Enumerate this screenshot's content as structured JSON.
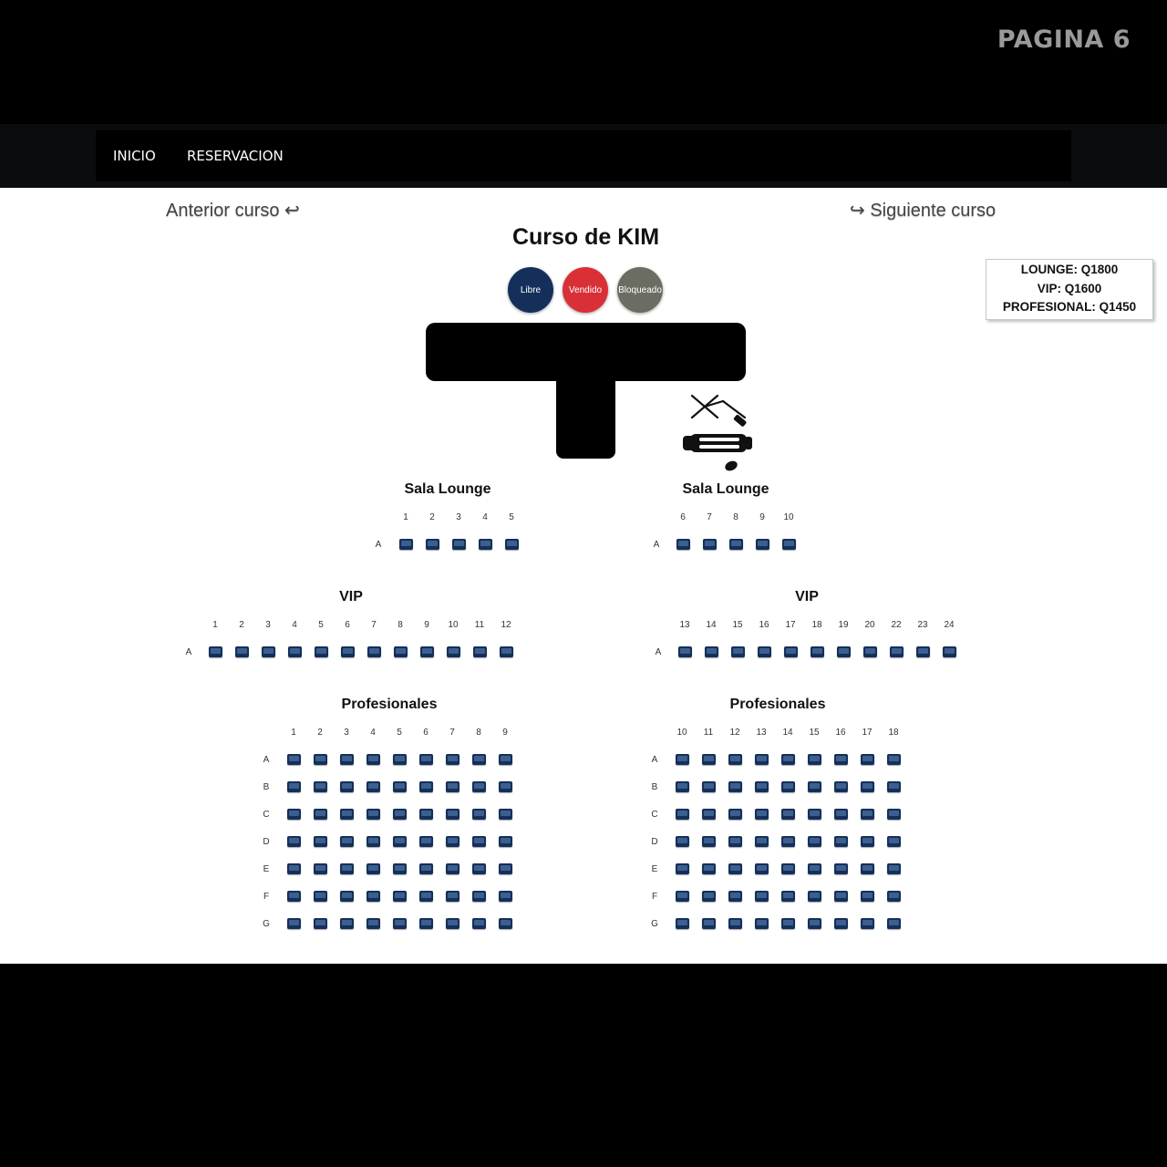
{
  "page_label": "PAGINA 6",
  "nav": {
    "items": [
      "INICIO",
      "RESERVACION"
    ]
  },
  "course": {
    "prev_label": "Anterior curso ↩",
    "next_label": "↪ Siguiente curso",
    "title": "Curso de KIM"
  },
  "legend": [
    {
      "label": "Libre",
      "color": "#14305a"
    },
    {
      "label": "Vendido",
      "color": "#d93038"
    },
    {
      "label": "Bloqueado",
      "color": "#6c6d62"
    }
  ],
  "prices": [
    "LOUNGE: Q1800",
    "VIP: Q1600",
    "PROFESIONAL: Q1450"
  ],
  "seat_color": "#14305a",
  "sections": [
    {
      "name": "Sala Lounge",
      "columns": [
        "1",
        "2",
        "3",
        "4",
        "5"
      ],
      "rows": [
        "A"
      ]
    },
    {
      "name": "Sala Lounge",
      "columns": [
        "6",
        "7",
        "8",
        "9",
        "10"
      ],
      "rows": [
        "A"
      ]
    },
    {
      "name": "VIP",
      "columns": [
        "1",
        "2",
        "3",
        "4",
        "5",
        "6",
        "7",
        "8",
        "9",
        "10",
        "11",
        "12"
      ],
      "rows": [
        "A"
      ]
    },
    {
      "name": "VIP",
      "columns": [
        "13",
        "14",
        "15",
        "16",
        "17",
        "18",
        "19",
        "20",
        "22",
        "23",
        "24"
      ],
      "rows": [
        "A"
      ]
    },
    {
      "name": "Profesionales",
      "columns": [
        "1",
        "2",
        "3",
        "4",
        "5",
        "6",
        "7",
        "8",
        "9"
      ],
      "rows": [
        "A",
        "B",
        "C",
        "D",
        "E",
        "F",
        "G"
      ]
    },
    {
      "name": "Profesionales",
      "columns": [
        "10",
        "11",
        "12",
        "13",
        "14",
        "15",
        "16",
        "17",
        "18"
      ],
      "rows": [
        "A",
        "B",
        "C",
        "D",
        "E",
        "F",
        "G"
      ]
    }
  ]
}
